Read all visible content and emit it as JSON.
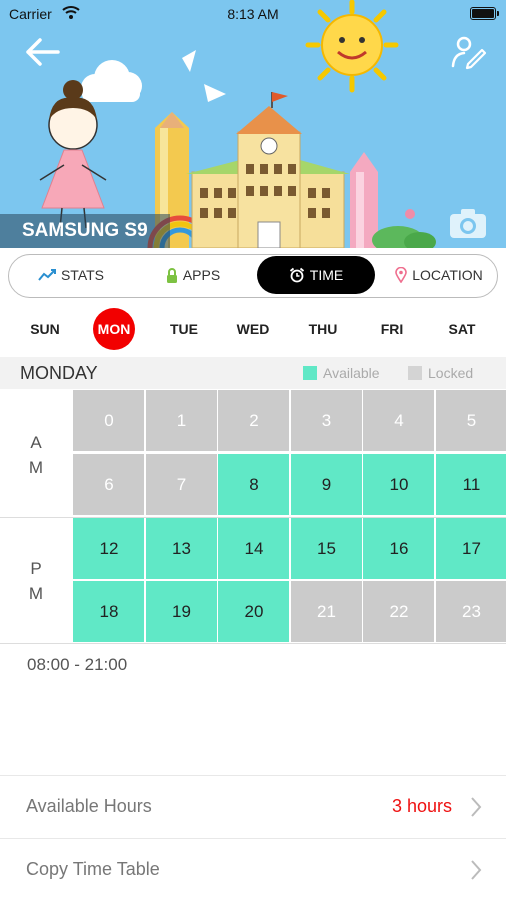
{
  "status_bar": {
    "carrier": "Carrier",
    "time": "8:13 AM"
  },
  "device": {
    "name": "SAMSUNG S9"
  },
  "tabs": [
    {
      "label": "STATS",
      "icon": "chart-line-icon",
      "active": false
    },
    {
      "label": "APPS",
      "icon": "lock-icon",
      "active": false
    },
    {
      "label": "TIME",
      "icon": "alarm-clock-icon",
      "active": true
    },
    {
      "label": "LOCATION",
      "icon": "map-pin-icon",
      "active": false
    }
  ],
  "days": [
    {
      "label": "SUN",
      "active": false
    },
    {
      "label": "MON",
      "active": true
    },
    {
      "label": "TUE",
      "active": false
    },
    {
      "label": "WED",
      "active": false
    },
    {
      "label": "THU",
      "active": false
    },
    {
      "label": "FRI",
      "active": false
    },
    {
      "label": "SAT",
      "active": false
    }
  ],
  "schedule": {
    "title": "MONDAY",
    "legend": {
      "available": "Available",
      "locked": "Locked"
    },
    "colors": {
      "available": "#60e8c6",
      "locked": "#cbcbcb",
      "accent": "#f20000"
    },
    "am_label": [
      "A",
      "M"
    ],
    "pm_label": [
      "P",
      "M"
    ],
    "hours": [
      {
        "hour": "0",
        "available": false
      },
      {
        "hour": "1",
        "available": false
      },
      {
        "hour": "2",
        "available": false
      },
      {
        "hour": "3",
        "available": false
      },
      {
        "hour": "4",
        "available": false
      },
      {
        "hour": "5",
        "available": false
      },
      {
        "hour": "6",
        "available": false
      },
      {
        "hour": "7",
        "available": false
      },
      {
        "hour": "8",
        "available": true
      },
      {
        "hour": "9",
        "available": true
      },
      {
        "hour": "10",
        "available": true
      },
      {
        "hour": "11",
        "available": true
      },
      {
        "hour": "12",
        "available": true
      },
      {
        "hour": "13",
        "available": true
      },
      {
        "hour": "14",
        "available": true
      },
      {
        "hour": "15",
        "available": true
      },
      {
        "hour": "16",
        "available": true
      },
      {
        "hour": "17",
        "available": true
      },
      {
        "hour": "18",
        "available": true
      },
      {
        "hour": "19",
        "available": true
      },
      {
        "hour": "20",
        "available": true
      },
      {
        "hour": "21",
        "available": false
      },
      {
        "hour": "22",
        "available": false
      },
      {
        "hour": "23",
        "available": false
      }
    ],
    "range": "08:00 - 21:00"
  },
  "available_hours": {
    "label": "Available Hours",
    "value": "3 hours"
  },
  "copy_table": {
    "label": "Copy Time Table"
  }
}
